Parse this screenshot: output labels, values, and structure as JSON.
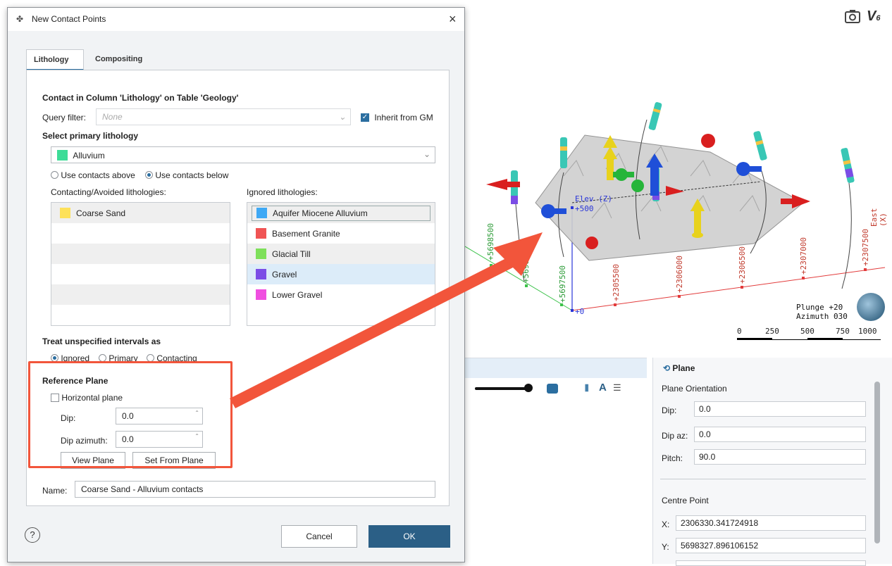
{
  "app": {
    "toolbar_icons": [
      "camera-icon",
      "v-logo-icon"
    ]
  },
  "viewport": {
    "elev_label": "Elev (Z)",
    "east_label": "East (X)",
    "north_ticks": [
      "+5698500",
      "+5698000",
      "+5697500"
    ],
    "east_ticks": [
      "+2305500",
      "+2306000",
      "+2306500",
      "+2307000",
      "+2307500"
    ],
    "elev_ticks": [
      "+500",
      "+0"
    ],
    "plunge": "Plunge +20",
    "azimuth": "Azimuth 030",
    "scale_ticks": [
      "0",
      "250",
      "500",
      "750",
      "1000"
    ]
  },
  "plane_panel": {
    "title": "Plane",
    "orientation_heading": "Plane Orientation",
    "dip_label": "Dip:",
    "dip_value": "0.0",
    "dipaz_label": "Dip az:",
    "dipaz_value": "0.0",
    "pitch_label": "Pitch:",
    "pitch_value": "90.0",
    "centre_heading": "Centre Point",
    "x_label": "X:",
    "x_value": "2306330.341724918",
    "y_label": "Y:",
    "y_value": "5698327.896106152"
  },
  "dialog": {
    "title": "New Contact Points",
    "close": "×",
    "tabs": [
      "Lithology",
      "Compositing"
    ],
    "contact_heading": "Contact in Column 'Lithology' on Table 'Geology'",
    "query_label": "Query filter:",
    "query_placeholder": "None",
    "inherit_label": "Inherit from GM",
    "select_primary": "Select primary lithology",
    "primary_value": "Alluvium",
    "primary_color": "#3ddc97",
    "use_above": "Use contacts above",
    "use_below": "Use contacts below",
    "contacting_label": "Contacting/Avoided lithologies:",
    "ignored_label": "Ignored lithologies:",
    "contacting_items": [
      {
        "name": "Coarse Sand",
        "color": "#fde15a"
      }
    ],
    "ignored_items": [
      {
        "name": "Aquifer Miocene Alluvium",
        "color": "#3fa9f5"
      },
      {
        "name": "Basement Granite",
        "color": "#f05454"
      },
      {
        "name": "Glacial Till",
        "color": "#7ee05a"
      },
      {
        "name": "Gravel",
        "color": "#7b4de6"
      },
      {
        "name": "Lower Gravel",
        "color": "#f04fe0"
      }
    ],
    "treat_heading": "Treat unspecified intervals as",
    "treat_options": [
      "Ignored",
      "Primary",
      "Contacting"
    ],
    "ref_heading": "Reference Plane",
    "horizontal_label": "Horizontal plane",
    "dip_label": "Dip:",
    "dip_value": "0.0",
    "dipaz_label": "Dip azimuth:",
    "dipaz_value": "0.0",
    "view_plane": "View Plane",
    "set_from_plane": "Set From Plane",
    "name_label": "Name:",
    "name_value": "Coarse Sand - Alluvium contacts",
    "help": "?",
    "cancel": "Cancel",
    "ok": "OK"
  },
  "colors": {
    "accent": "#2b5f86",
    "highlight": "#f2553b"
  }
}
